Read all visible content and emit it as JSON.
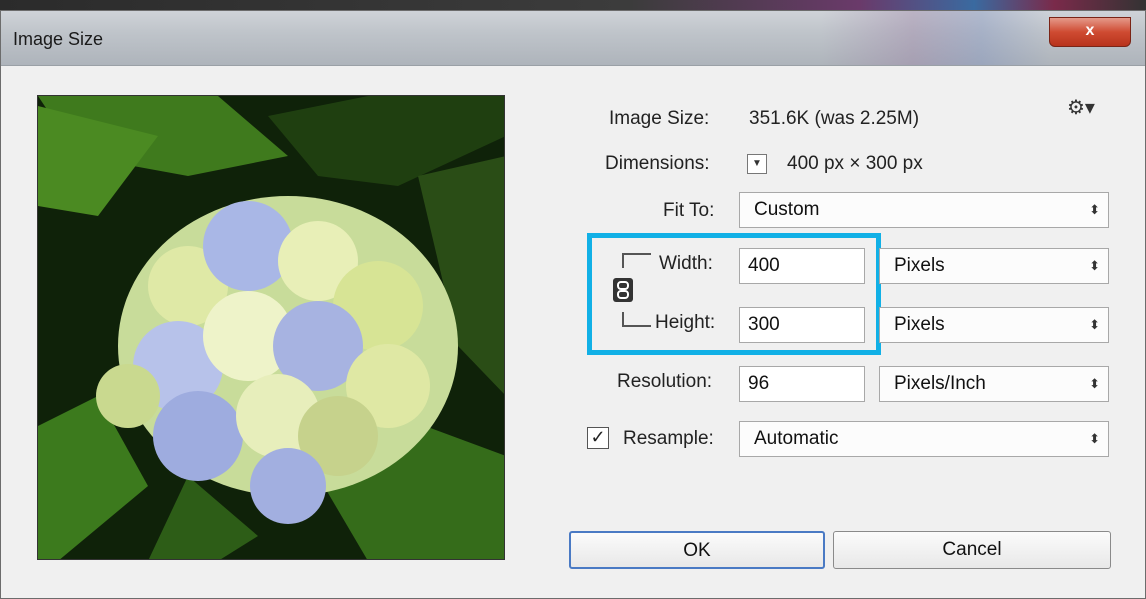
{
  "window": {
    "title": "Image Size",
    "close_label": "x"
  },
  "info": {
    "image_size_label": "Image Size:",
    "image_size_value": "351.6K (was 2.25M)",
    "dimensions_label": "Dimensions:",
    "dimensions_value": "400 px  ×  300 px"
  },
  "fit_to": {
    "label": "Fit To:",
    "value": "Custom"
  },
  "width": {
    "label": "Width:",
    "value": "400",
    "unit": "Pixels"
  },
  "height": {
    "label": "Height:",
    "value": "300",
    "unit": "Pixels"
  },
  "resolution": {
    "label": "Resolution:",
    "value": "96",
    "unit": "Pixels/Inch"
  },
  "resample": {
    "label": "Resample:",
    "checked": true,
    "value": "Automatic"
  },
  "buttons": {
    "ok": "OK",
    "cancel": "Cancel"
  },
  "icons": {
    "gear": "gear-icon",
    "link": "chain-link-icon",
    "dropdown": "dropdown-arrow-icon",
    "select_arrow": "up-down-arrow-icon"
  },
  "colors": {
    "highlight": "#11b0e6",
    "close": "#cf4b32"
  }
}
